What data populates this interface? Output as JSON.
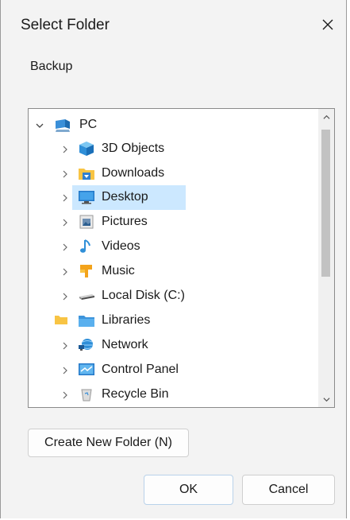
{
  "dialog": {
    "title": "Select Folder",
    "description": "Backup"
  },
  "tree": {
    "items": [
      {
        "label": "PC",
        "icon": "pc-icon",
        "expanded": true
      },
      {
        "label": "3D Objects",
        "icon": "3d-objects-icon"
      },
      {
        "label": "Downloads",
        "icon": "downloads-icon"
      },
      {
        "label": "Desktop",
        "icon": "desktop-icon",
        "selected": true
      },
      {
        "label": "Pictures",
        "icon": "pictures-icon"
      },
      {
        "label": "Videos",
        "icon": "videos-icon"
      },
      {
        "label": "Music",
        "icon": "music-icon"
      },
      {
        "label": "Local Disk (C:)",
        "icon": "local-disk-icon"
      },
      {
        "label": "Libraries",
        "icon": "libraries-icon"
      },
      {
        "label": "Network",
        "icon": "network-icon"
      },
      {
        "label": "Control Panel",
        "icon": "control-panel-icon"
      },
      {
        "label": "Recycle Bin",
        "icon": "recycle-bin-icon"
      }
    ]
  },
  "buttons": {
    "new_folder": "Create New Folder (N)",
    "ok": "OK",
    "cancel": "Cancel"
  },
  "colors": {
    "selection": "#cce8ff",
    "folder_yellow": "#f8c444",
    "accent_blue": "#2f8fd8"
  }
}
